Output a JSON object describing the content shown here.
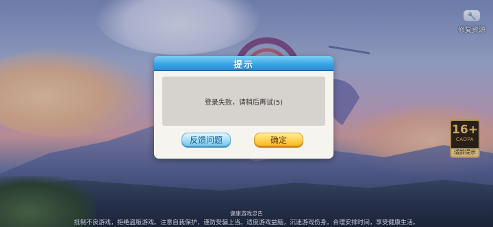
{
  "top_right": {
    "fix_label": "修复资源",
    "fix_icon": "wrench-icon"
  },
  "age_rating": {
    "number": "16+",
    "org": "CADPA",
    "tip": "适龄提示"
  },
  "dialog": {
    "title": "提示",
    "message": "登录失败，请稍后再试(5)",
    "feedback_label": "反馈问题",
    "confirm_label": "确定"
  },
  "notice": {
    "title": "健康游戏忠告",
    "text": "抵制不良游戏，拒绝盗版游戏。注意自我保护，谨防受骗上当。适度游戏益脑，沉迷游戏伤身。合理安排时间，享受健康生活。"
  },
  "colors": {
    "dialog_header": "#3aa3e6",
    "confirm_button": "#ffd34f",
    "feedback_button": "#a6def6"
  }
}
